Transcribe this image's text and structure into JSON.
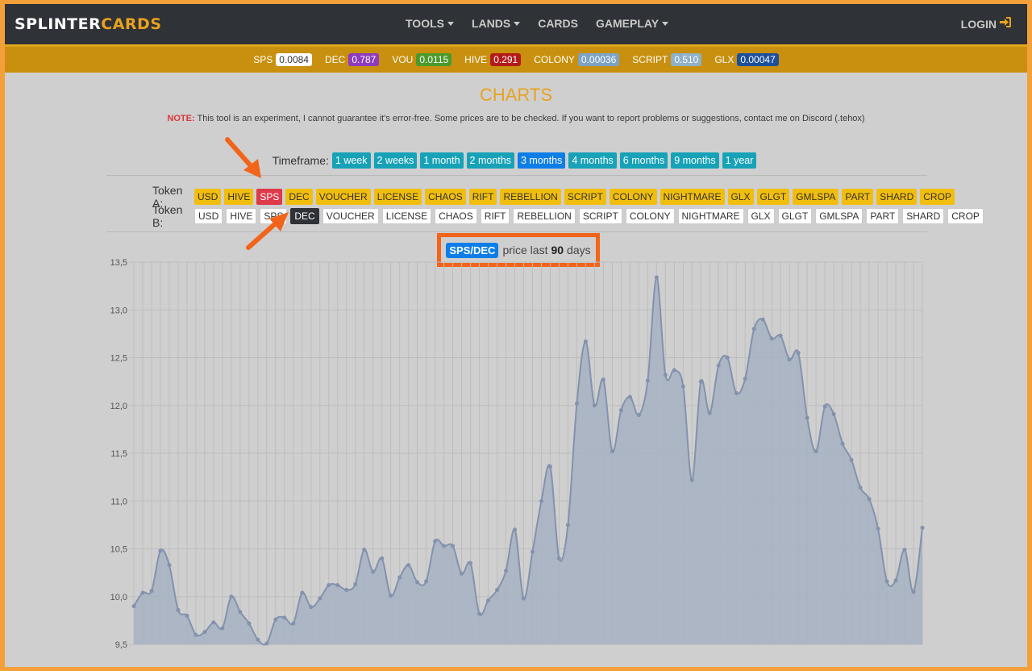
{
  "brand": {
    "part1": "SPLINTER",
    "part2": "CARDS"
  },
  "nav": {
    "items": [
      {
        "label": "TOOLS",
        "dropdown": true
      },
      {
        "label": "LANDS",
        "dropdown": true
      },
      {
        "label": "CARDS",
        "dropdown": false
      },
      {
        "label": "GAMEPLAY",
        "dropdown": true
      }
    ],
    "login": "LOGIN"
  },
  "prices": [
    {
      "label": "SPS",
      "value": "0.0084",
      "color": "#ffffff",
      "text": "#333333"
    },
    {
      "label": "DEC",
      "value": "0.787",
      "color": "#8e3bbf",
      "text": "#ffffff"
    },
    {
      "label": "VOU",
      "value": "0.0115",
      "color": "#4a9a2c",
      "text": "#ffffff"
    },
    {
      "label": "HIVE",
      "value": "0.291",
      "color": "#b31b1b",
      "text": "#ffffff"
    },
    {
      "label": "COLONY",
      "value": "0.00036",
      "color": "#7da3c4",
      "text": "#ffffff"
    },
    {
      "label": "SCRIPT",
      "value": "0.510",
      "color": "#8fb0c9",
      "text": "#ffffff"
    },
    {
      "label": "GLX",
      "value": "0.00047",
      "color": "#1d4f9c",
      "text": "#ffffff"
    }
  ],
  "page": {
    "title": "CHARTS",
    "note_prefix": "NOTE:",
    "note_text": " This tool is an experiment, I cannot guarantee it's error-free. Some prices are to be checked. If you want to report problems or suggestions, contact me on Discord (.tehox)"
  },
  "timeframe": {
    "label": "Timeframe:",
    "options": [
      "1 week",
      "2 weeks",
      "1 month",
      "2 months",
      "3 months",
      "4 months",
      "6 months",
      "9 months",
      "1 year"
    ],
    "active": "3 months"
  },
  "tokens": {
    "label_a": "Token A:",
    "label_b": "Token B:",
    "list": [
      "USD",
      "HIVE",
      "SPS",
      "DEC",
      "VOUCHER",
      "LICENSE",
      "CHAOS",
      "RIFT",
      "REBELLION",
      "SCRIPT",
      "COLONY",
      "NIGHTMARE",
      "GLX",
      "GLGT",
      "GMLSPA",
      "PART",
      "SHARD",
      "CROP"
    ],
    "selected_a": "SPS",
    "selected_b": "DEC"
  },
  "pair_header": {
    "pair": "SPS/DEC",
    "text1": "price last",
    "days": "90",
    "text2": "days"
  },
  "chart_data": {
    "type": "area",
    "series": [
      {
        "values": [
          9.9,
          10.04,
          10.06,
          10.48,
          10.33,
          9.86,
          9.8,
          9.6,
          9.63,
          9.73,
          9.67,
          10.0,
          9.84,
          9.72,
          9.55,
          9.51,
          9.76,
          9.78,
          9.72,
          10.04,
          9.89,
          9.98,
          10.12,
          10.12,
          10.07,
          10.13,
          10.49,
          10.26,
          10.4,
          10.01,
          10.2,
          10.33,
          10.15,
          10.16,
          10.58,
          10.53,
          10.53,
          10.24,
          10.35,
          9.82,
          9.96,
          10.07,
          10.27,
          10.7,
          9.98,
          10.47,
          11.0,
          11.36,
          10.4,
          10.75,
          12.02,
          12.67,
          12.0,
          12.27,
          11.52,
          11.95,
          12.09,
          11.9,
          12.26,
          13.34,
          12.32,
          12.37,
          12.2,
          11.22,
          12.25,
          11.92,
          12.42,
          12.5,
          12.13,
          12.28,
          12.8,
          12.9,
          12.7,
          12.73,
          12.48,
          12.55,
          11.87,
          11.52,
          11.99,
          11.91,
          11.6,
          11.43,
          11.14,
          11.02,
          10.71,
          10.16,
          10.17,
          10.49,
          10.05,
          10.72
        ]
      }
    ],
    "yticks": [
      "13,5",
      "13,0",
      "12,5",
      "12,0",
      "11,5",
      "11,0",
      "10,5",
      "10,0",
      "9,5"
    ],
    "ylim": [
      9.5,
      13.5
    ],
    "grid": true,
    "fill_color": "#a6b1c2",
    "line_color": "#8392ad"
  }
}
